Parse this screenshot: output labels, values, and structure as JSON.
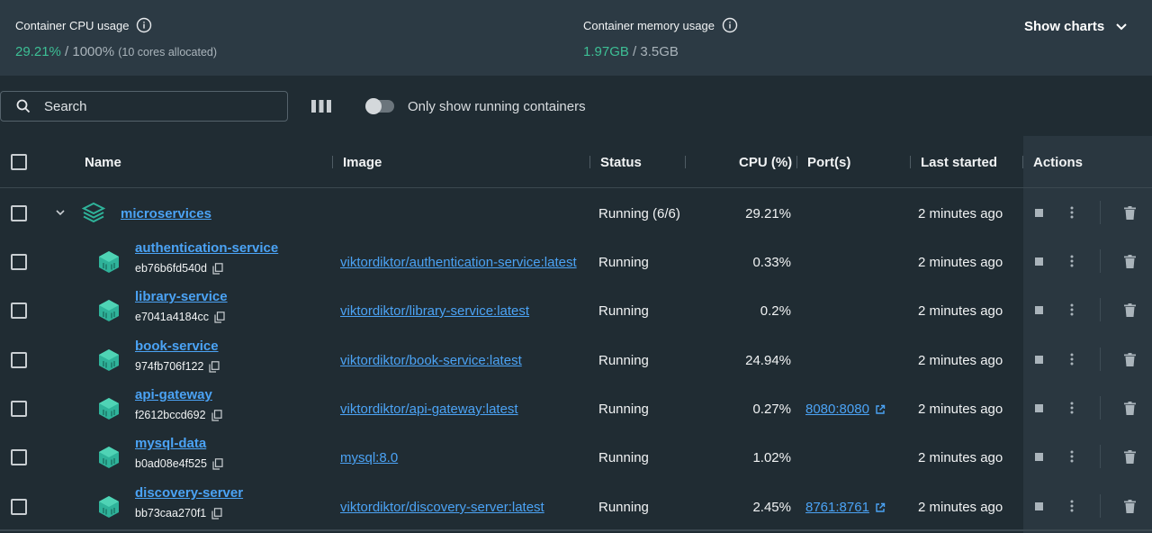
{
  "stats": {
    "cpu_title": "Container CPU usage",
    "cpu_value": "29.21%",
    "cpu_total": " / 1000%",
    "cpu_note": "(10 cores allocated)",
    "mem_title": "Container memory usage",
    "mem_value": "1.97GB",
    "mem_total": " / 3.5GB",
    "show_charts": "Show charts"
  },
  "toolbar": {
    "search_placeholder": "Search",
    "toggle_label": "Only show running containers",
    "toggle_on": false
  },
  "table": {
    "headers": {
      "name": "Name",
      "image": "Image",
      "status": "Status",
      "cpu": "CPU (%)",
      "ports": "Port(s)",
      "last_started": "Last started",
      "actions": "Actions"
    },
    "group": {
      "name": "microservices",
      "status": "Running (6/6)",
      "cpu": "29.21%",
      "last_started": "2 minutes ago"
    },
    "rows": [
      {
        "name": "authentication-service",
        "id": "eb76b6fd540d",
        "image": "viktordiktor/authentication-service:latest",
        "status": "Running",
        "cpu": "0.33%",
        "port": "",
        "last_started": "2 minutes ago"
      },
      {
        "name": "library-service",
        "id": "e7041a4184cc",
        "image": "viktordiktor/library-service:latest",
        "status": "Running",
        "cpu": "0.2%",
        "port": "",
        "last_started": "2 minutes ago"
      },
      {
        "name": "book-service",
        "id": "974fb706f122",
        "image": "viktordiktor/book-service:latest",
        "status": "Running",
        "cpu": "24.94%",
        "port": "",
        "last_started": "2 minutes ago"
      },
      {
        "name": "api-gateway",
        "id": "f2612bccd692",
        "image": "viktordiktor/api-gateway:latest",
        "status": "Running",
        "cpu": "0.27%",
        "port": "8080:8080",
        "last_started": "2 minutes ago"
      },
      {
        "name": "mysql-data",
        "id": "b0ad08e4f525",
        "image": "mysql:8.0",
        "status": "Running",
        "cpu": "1.02%",
        "port": "",
        "last_started": "2 minutes ago"
      },
      {
        "name": "discovery-server",
        "id": "bb73caa270f1",
        "image": "viktordiktor/discovery-server:latest",
        "status": "Running",
        "cpu": "2.45%",
        "port": "8761:8761",
        "last_started": "2 minutes ago"
      }
    ]
  },
  "icons": {
    "info": "info-icon",
    "chevron": "chevron-down-icon",
    "search": "search-icon",
    "columns": "columns-icon",
    "stack": "stack-icon",
    "container": "container-icon",
    "copy": "copy-icon",
    "external": "external-link-icon",
    "stop": "stop-icon",
    "more": "more-vertical-icon",
    "delete": "trash-icon"
  },
  "colors": {
    "accent_green": "#3dbf95",
    "link_blue": "#4ba3f5",
    "container_teal": "#2fb39a",
    "background": "#202c33"
  }
}
